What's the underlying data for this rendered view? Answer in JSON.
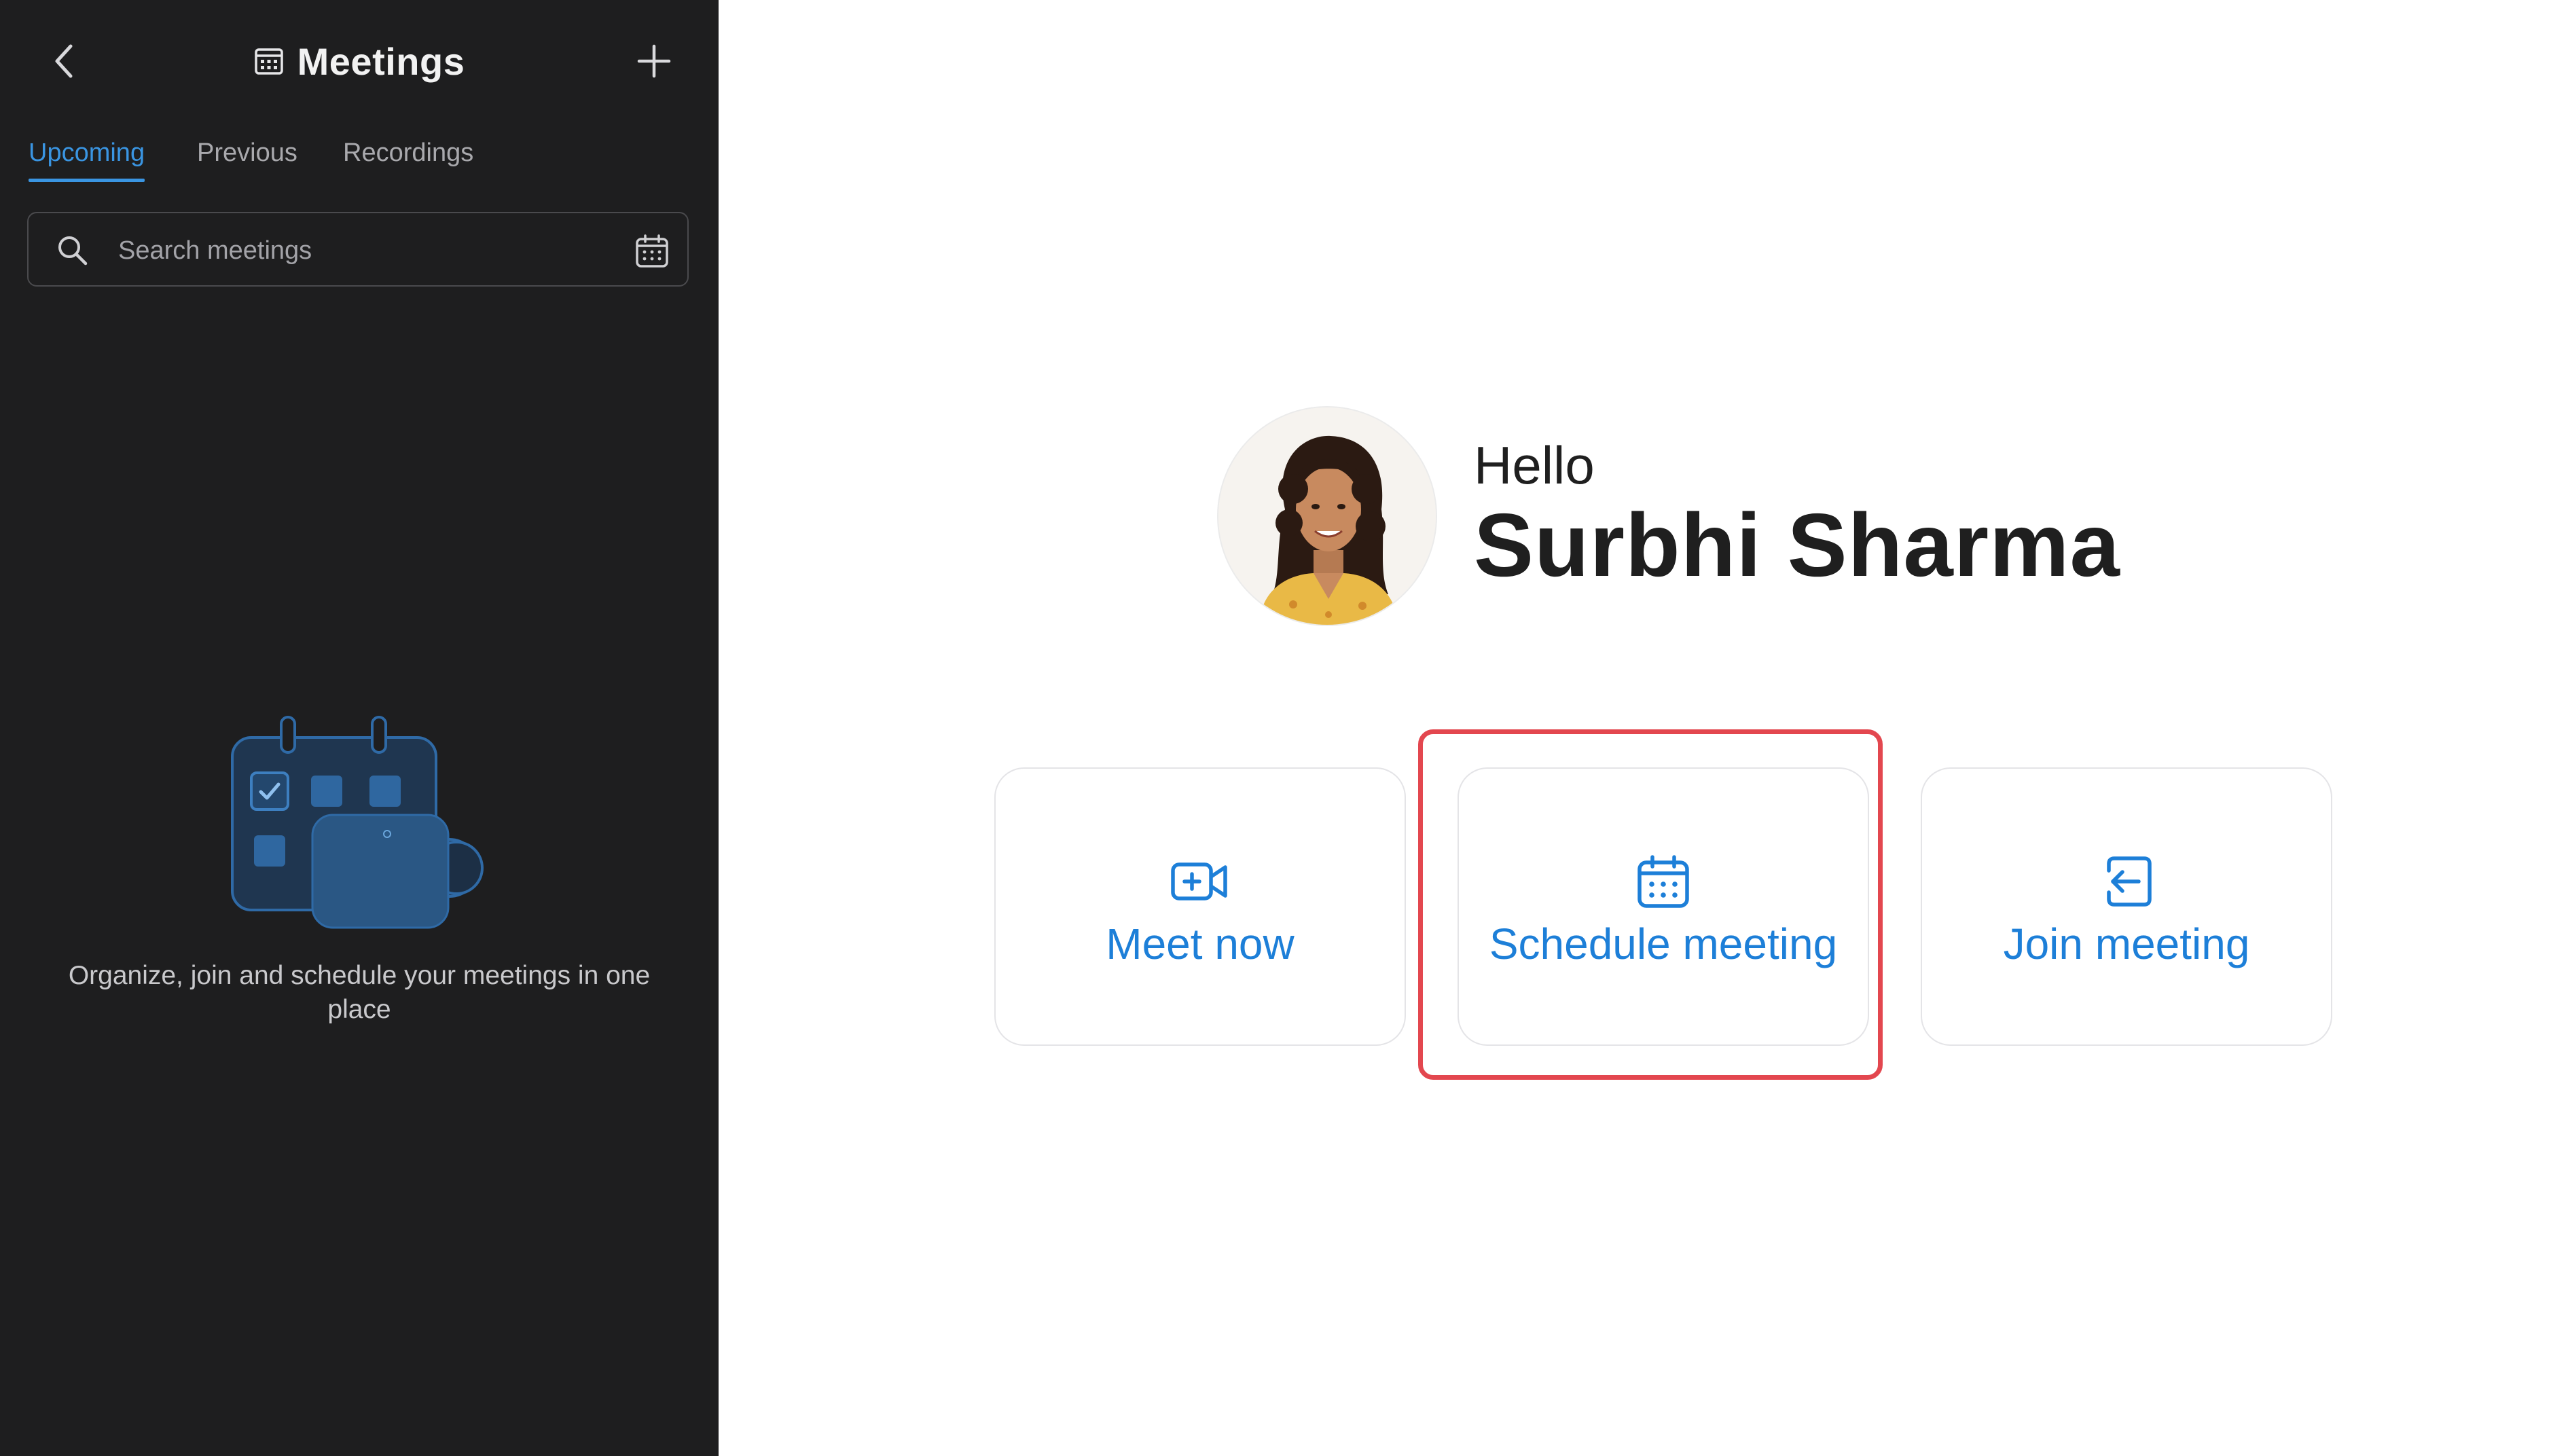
{
  "sidebar": {
    "title": "Meetings",
    "back_icon": "chevron-left-icon",
    "add_icon": "plus-icon",
    "tabs": [
      {
        "label": "Upcoming",
        "active": true
      },
      {
        "label": "Previous",
        "active": false
      },
      {
        "label": "Recordings",
        "active": false
      }
    ],
    "search": {
      "placeholder": "Search meetings"
    },
    "empty_state": {
      "text": "Organize, join and schedule your meetings in one place"
    }
  },
  "main": {
    "greeting": "Hello",
    "user_name": "Surbhi Sharma",
    "actions": [
      {
        "label": "Meet now",
        "icon": "video-plus-icon"
      },
      {
        "label": "Schedule meeting",
        "icon": "calendar-icon",
        "highlighted": true
      },
      {
        "label": "Join meeting",
        "icon": "join-icon"
      }
    ]
  },
  "colors": {
    "sidebar_bg": "#1e1e1f",
    "accent": "#1d7fd8",
    "highlight": "#e3474f"
  }
}
